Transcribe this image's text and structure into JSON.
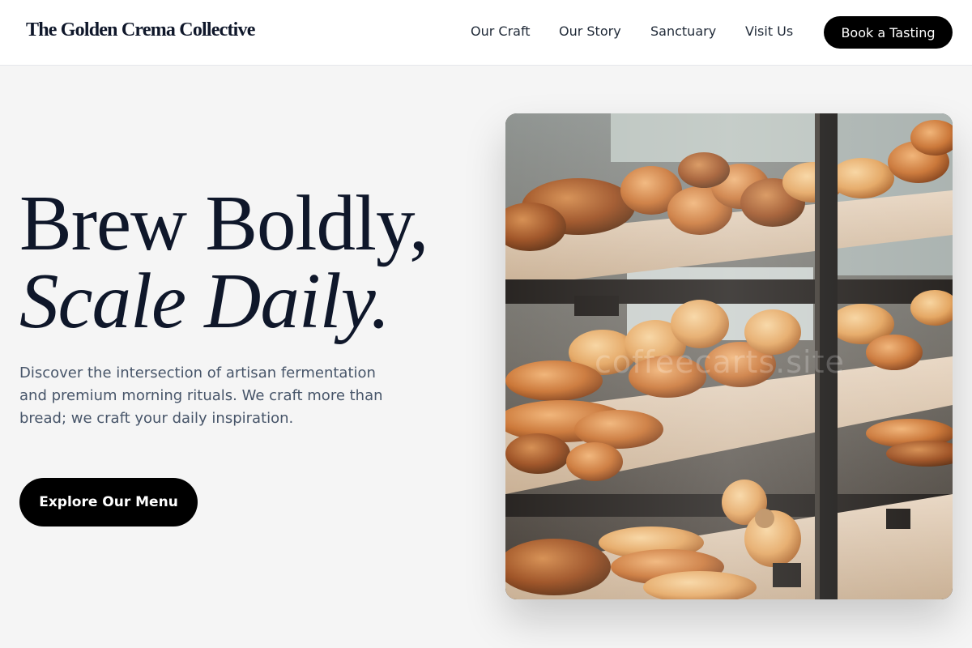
{
  "header": {
    "brand": "The Golden Crema Collective",
    "nav": [
      {
        "label": "Our Craft"
      },
      {
        "label": "Our Story"
      },
      {
        "label": "Sanctuary"
      },
      {
        "label": "Visit Us"
      }
    ],
    "cta_label": "Book a Tasting"
  },
  "hero": {
    "headline_line1": "Brew Boldly,",
    "headline_line2": "Scale Daily.",
    "description": "Discover the intersection of artisan fermentation and premium morning rituals. We craft more than bread; we craft your daily inspiration.",
    "cta_label": "Explore Our Menu",
    "image": {
      "subject": "bakery display case with breads and pastries",
      "watermark": "coffeecarts.site"
    }
  },
  "colors": {
    "background": "#f5f5f5",
    "header_bg": "#ffffff",
    "heading": "#0f172a",
    "body_text": "#475569",
    "button_bg": "#000000",
    "button_text": "#ffffff"
  }
}
